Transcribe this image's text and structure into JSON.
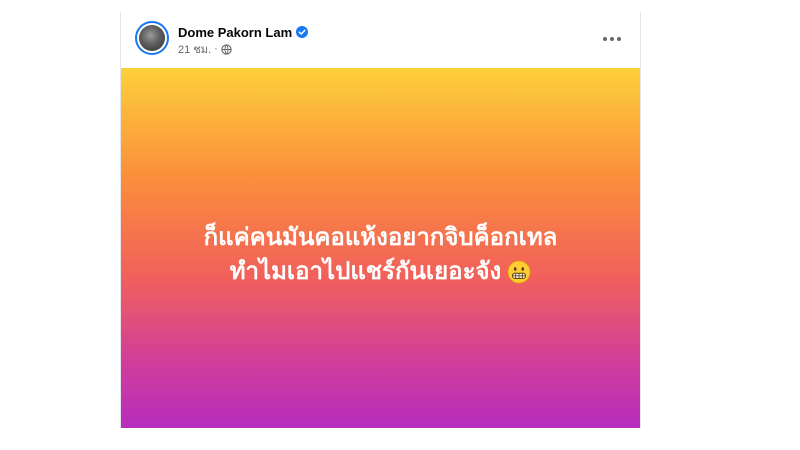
{
  "post": {
    "author_name": "Dome Pakorn Lam",
    "verified": true,
    "timestamp": "21 ชม.",
    "separator": "·",
    "audience_icon": "globe-icon",
    "more_icon": "more-options-icon",
    "text_line_1": "ก็แค่คนมันคอแห้งอยากจิบค็อกเทล",
    "text_line_2": "ทำไมเอาไปแชร์กันเยอะจัง",
    "emoji_icon": "grimacing-face-emoji",
    "background_gradient": [
      "#fdd03b",
      "#fb8f3b",
      "#f1605b",
      "#d03e9c",
      "#b62cbd"
    ],
    "text_color": "#ffffff",
    "verified_color": "#1877f2"
  }
}
